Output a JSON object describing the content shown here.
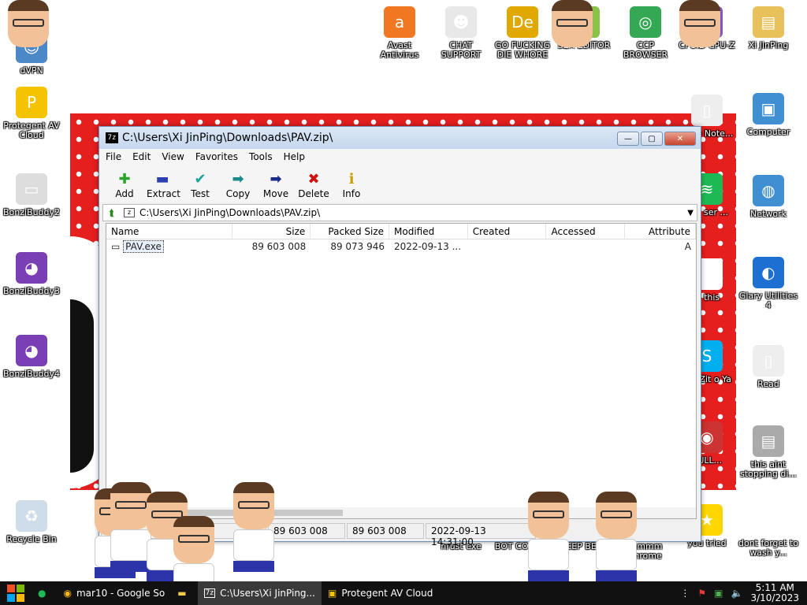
{
  "desktop_icons": [
    {
      "label": "dVPN",
      "glyph": "☺",
      "color": "#4a88c7"
    },
    {
      "label": "Protegent AV Cloud",
      "glyph": "P",
      "color": "#f5c400"
    },
    {
      "label": "BonziBuddy2",
      "glyph": "▭",
      "color": "#dddddd"
    },
    {
      "label": "BonziBuddy3",
      "glyph": "◕",
      "color": "#7a3fb5"
    },
    {
      "label": "BonziBuddy4",
      "glyph": "◕",
      "color": "#7a3fb5"
    },
    {
      "label": "Recycle Bin",
      "glyph": "♻",
      "color": "#cfdce9"
    },
    {
      "label": "Avast Antivirus",
      "glyph": "a",
      "color": "#f07822"
    },
    {
      "label": "CHAT SUPPORT",
      "glyph": "☻",
      "color": "#e8e8e8"
    },
    {
      "label": "GO FUCKING DIE WHORE",
      "glyph": "De",
      "color": "#e0a800"
    },
    {
      "label": "SEX EDITOR",
      "glyph": "✎",
      "color": "#8bc34a"
    },
    {
      "label": "CCP BROWSER",
      "glyph": "◎",
      "color": "#34a853"
    },
    {
      "label": "CPUID CPU-Z",
      "glyph": "▦",
      "color": "#7e57c2"
    },
    {
      "label": "Xi JinPing",
      "glyph": "▤",
      "color": "#e8c15a"
    },
    {
      "label": "Computer",
      "glyph": "▣",
      "color": "#3f8fd2"
    },
    {
      "label": "Network",
      "glyph": "◍",
      "color": "#3f8fd2"
    },
    {
      "label": "Glary Utilities 4",
      "glyph": "◐",
      "color": "#1e6fd2"
    },
    {
      "label": "ware Note...",
      "glyph": "▯",
      "color": "#eeeeee"
    },
    {
      "label": "sed ser ...",
      "glyph": "≋",
      "color": "#1db954"
    },
    {
      "label": "is this",
      "glyph": "▦",
      "color": "#ffffff"
    },
    {
      "label": "hat Zit o Ya",
      "glyph": "S",
      "color": "#00aff0"
    },
    {
      "label": "BULL...",
      "glyph": "◉",
      "color": "#cc3333"
    },
    {
      "label": "Read",
      "glyph": "▯",
      "color": "#eeeeee"
    },
    {
      "label": "this aint stopping di...",
      "glyph": "▤",
      "color": "#aaaaaa"
    },
    {
      "label": "you tried",
      "glyph": "★",
      "color": "#ffd700"
    },
    {
      "label": "dont forget to wash y...",
      "glyph": "▦",
      "color": "#ffffff"
    },
    {
      "label": "nrust exe",
      "glyph": "",
      "color": "#ffffff"
    },
    {
      "label": "BOT COLLAB",
      "glyph": "",
      "color": "#ffffff"
    },
    {
      "label": "EEP BEE",
      "glyph": "",
      "color": "#ffffff"
    },
    {
      "label": "mmmm chrome",
      "glyph": "",
      "color": "#ffffff"
    }
  ],
  "window": {
    "title": "C:\\Users\\Xi JinPing\\Downloads\\PAV.zip\\",
    "app_icon": "7z",
    "minimize": "—",
    "maximize": "▢",
    "close": "✕",
    "menu": [
      "File",
      "Edit",
      "View",
      "Favorites",
      "Tools",
      "Help"
    ],
    "toolbar": [
      {
        "label": "Add",
        "icon": "plus-icon",
        "glyph": "✚",
        "color": "#2aa52a"
      },
      {
        "label": "Extract",
        "icon": "minus-icon",
        "glyph": "▬",
        "color": "#2b3fb0"
      },
      {
        "label": "Test",
        "icon": "check-icon",
        "glyph": "✔",
        "color": "#1aa39a"
      },
      {
        "label": "Copy",
        "icon": "copy-arrow-icon",
        "glyph": "➡",
        "color": "#1a8a8a"
      },
      {
        "label": "Move",
        "icon": "move-arrow-icon",
        "glyph": "➡",
        "color": "#1a2a8a"
      },
      {
        "label": "Delete",
        "icon": "delete-x-icon",
        "glyph": "✖",
        "color": "#d01010"
      },
      {
        "label": "Info",
        "icon": "info-icon",
        "glyph": "ℹ",
        "color": "#c8a000"
      }
    ],
    "address": "C:\\Users\\Xi JinPing\\Downloads\\PAV.zip\\",
    "columns": [
      "Name",
      "Size",
      "Packed Size",
      "Modified",
      "Created",
      "Accessed",
      "Attribute"
    ],
    "rows": [
      {
        "name": "PAV.exe",
        "size": "89 603 008",
        "packed": "89 073 946",
        "modified": "2022-09-13 ...",
        "created": "",
        "accessed": "",
        "attr": "A"
      }
    ],
    "status": [
      "",
      "89 603 008",
      "89 603 008",
      "2022-09-13 14:31:00"
    ]
  },
  "taskbar": {
    "items": [
      {
        "label": "",
        "icon": "chat-icon"
      },
      {
        "label": "mar10 - Google So",
        "icon": "chrome-icon"
      },
      {
        "label": "",
        "icon": "folder-icon"
      },
      {
        "label": "C:\\Users\\Xi JinPing...",
        "icon": "7zip-icon"
      },
      {
        "label": "Protegent AV Cloud",
        "icon": "protegent-icon"
      }
    ],
    "time": "5:11 AM",
    "date": "3/10/2023"
  }
}
